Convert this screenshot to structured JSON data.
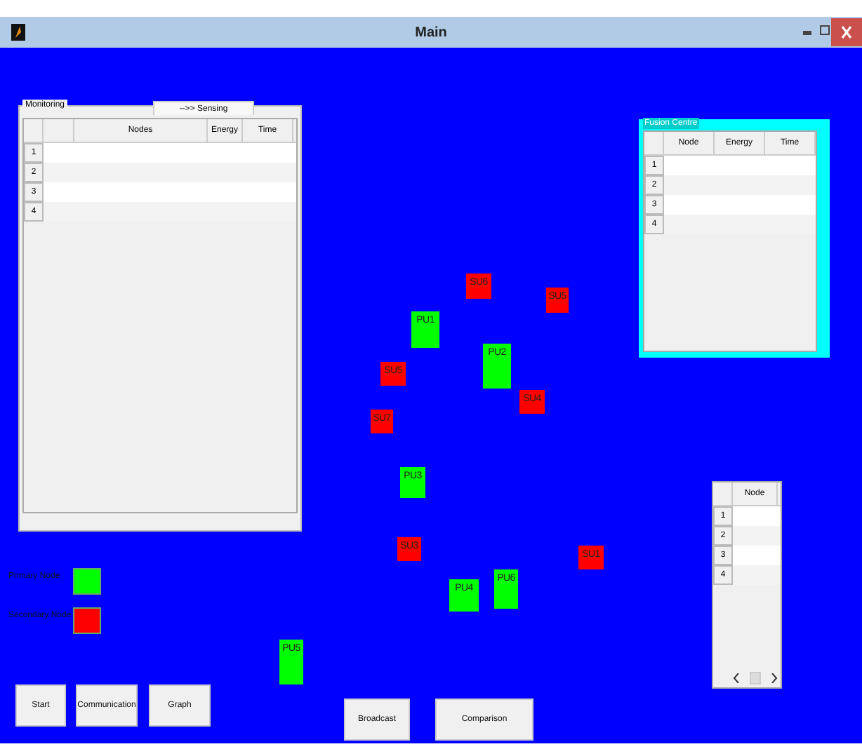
{
  "window": {
    "title": "Main"
  },
  "monitoring_panel": {
    "title": "Monitoring",
    "tabs": [
      {
        "label": "-->> Sensing",
        "selected": true
      }
    ],
    "table": {
      "columns": [
        "",
        "Nodes",
        "Energy",
        "Time"
      ],
      "rows": [
        "1",
        "2",
        "3",
        "4"
      ]
    }
  },
  "fusion_centre": {
    "title": "Fusion Centre",
    "table": {
      "columns": [
        "Node",
        "Energy",
        "Time"
      ],
      "rows": [
        "1",
        "2",
        "3",
        "4"
      ]
    }
  },
  "node_table": {
    "columns": [
      "Node"
    ],
    "rows": [
      "1",
      "2",
      "3",
      "4"
    ]
  },
  "nodes": [
    {
      "label": "SU6",
      "kind": "secondary"
    },
    {
      "label": "SU5",
      "kind": "secondary"
    },
    {
      "label": "PU1",
      "kind": "primary"
    },
    {
      "label": "PU2",
      "kind": "primary"
    },
    {
      "label": "SU5",
      "kind": "secondary"
    },
    {
      "label": "SU4",
      "kind": "secondary"
    },
    {
      "label": "SU7",
      "kind": "secondary"
    },
    {
      "label": "PU3",
      "kind": "primary"
    },
    {
      "label": "SU3",
      "kind": "secondary"
    },
    {
      "label": "SU1",
      "kind": "secondary"
    },
    {
      "label": "PU4",
      "kind": "primary"
    },
    {
      "label": "PU6",
      "kind": "primary"
    },
    {
      "label": "PU5",
      "kind": "primary"
    }
  ],
  "legend": [
    {
      "label": "Primary Node",
      "color": "#00ff00"
    },
    {
      "label": "Secondary Node",
      "color": "#ff0000"
    }
  ],
  "buttons": [
    "Start",
    "Communication",
    "Graph",
    "Broadcast",
    "Comparison"
  ]
}
